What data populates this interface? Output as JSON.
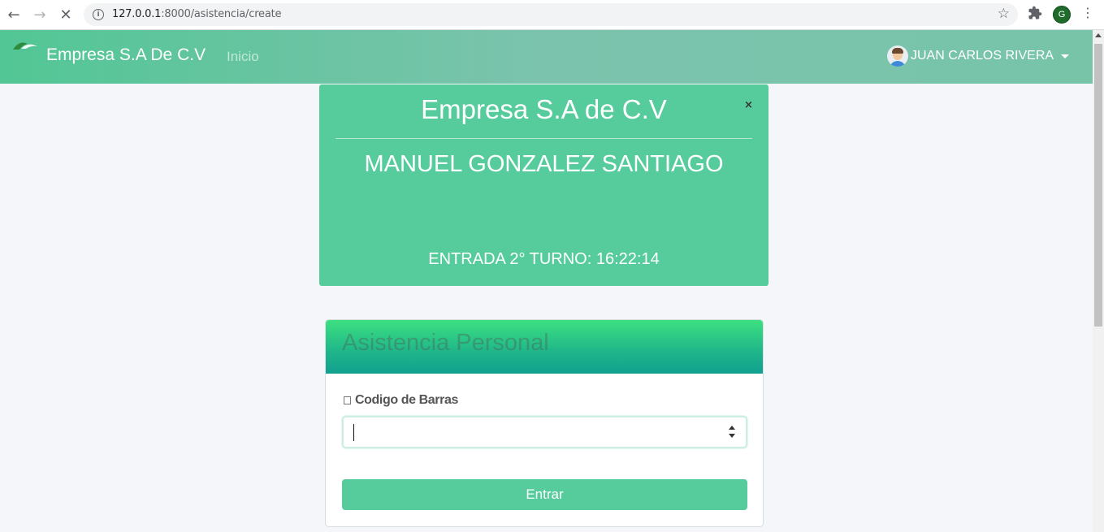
{
  "browser": {
    "url_host": "127.0.0.1",
    "url_rest": ":8000/asistencia/create",
    "back_icon": "←",
    "forward_icon": "→",
    "stop_icon": "✕",
    "info_icon": "i",
    "star_icon": "☆",
    "extensions_icon": "puzzle-icon",
    "profile_initial": "G",
    "menu_icon": "⋮"
  },
  "navbar": {
    "brand": "Empresa S.A De C.V",
    "links": [
      {
        "label": "Inicio"
      }
    ],
    "user_name": "JUAN CARLOS RIVERA"
  },
  "alert": {
    "title": "Empresa S.A de C.V",
    "close_label": "×",
    "employee_name": "MANUEL GONZALEZ SANTIAGO",
    "entry_text": "ENTRADA 2° TURNO: 16:22:14"
  },
  "card": {
    "title": "Asistencia Personal",
    "field_label": "Codigo de Barras",
    "input_value": "",
    "submit_label": "Entrar"
  },
  "colors": {
    "primary": "#56cc9d",
    "navbar_gradient_start": "#52c695",
    "navbar_gradient_end": "#77c4a9",
    "card_header_start": "#3de080",
    "card_header_end": "#11a08f",
    "background": "#f4f6f9"
  }
}
